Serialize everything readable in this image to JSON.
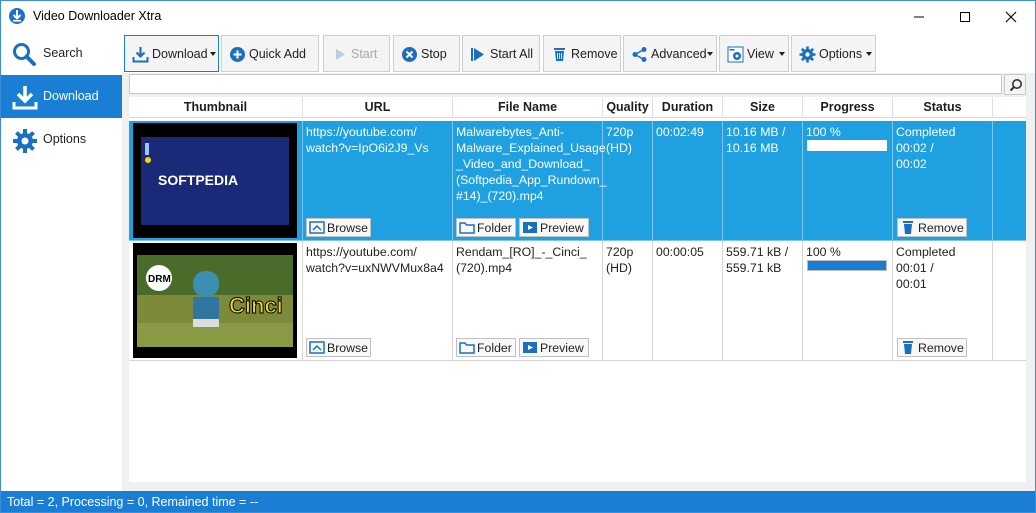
{
  "window": {
    "title": "Video Downloader Xtra"
  },
  "nav": {
    "items": [
      {
        "label": "Search",
        "icon": "search-icon",
        "active": false
      },
      {
        "label": "Download",
        "icon": "download-icon",
        "active": true
      },
      {
        "label": "Options",
        "icon": "gear-icon",
        "active": false
      }
    ]
  },
  "toolbar": {
    "download": "Download",
    "quick_add": "Quick Add",
    "start": "Start",
    "stop": "Stop",
    "start_all": "Start All",
    "remove": "Remove",
    "advanced": "Advanced",
    "view": "View",
    "options": "Options"
  },
  "search": {
    "value": ""
  },
  "table": {
    "headers": [
      "Thumbnail",
      "URL",
      "File Name",
      "Quality",
      "Duration",
      "Size",
      "Progress",
      "Status"
    ],
    "rows": [
      {
        "url": "https://youtube.com/\nwatch?v=IpO6i2J9_Vs",
        "file_name": "Malwarebytes_Anti-\nMalware_Explained_Usage\n_Video_and_Download_\n(Softpedia_App_Rundown_\n#14)_(720).mp4",
        "quality": "720p\n(HD)",
        "duration": "00:02:49",
        "size": "10.16 MB /\n10.16 MB",
        "progress_label": "100 %",
        "progress": 1.0,
        "status": "Completed\n00:02 /\n00:02",
        "thumb_text": "SOFTPEDIA",
        "browse": "Browse",
        "folder": "Folder",
        "preview": "Preview",
        "remove": "Remove"
      },
      {
        "url": "https://youtube.com/\nwatch?v=uxNWVMux8a4",
        "file_name": "Rendam_[RO]_-_Cinci_\n(720).mp4",
        "quality": "720p\n(HD)",
        "duration": "00:00:05",
        "size": "559.71 kB /\n559.71 kB",
        "progress_label": "100 %",
        "progress": 1.0,
        "status": "Completed\n00:01 /\n00:01",
        "thumb_text": "Cinci",
        "thumb_logo": "DRM",
        "browse": "Browse",
        "folder": "Folder",
        "preview": "Preview",
        "remove": "Remove"
      }
    ]
  },
  "status_bar": {
    "text": "Total = 2, Processing = 0, Remained time = --"
  },
  "colors": {
    "accent": "#1a7fd4",
    "selection": "#1fa0e0",
    "progress": "#1a7fd4"
  }
}
